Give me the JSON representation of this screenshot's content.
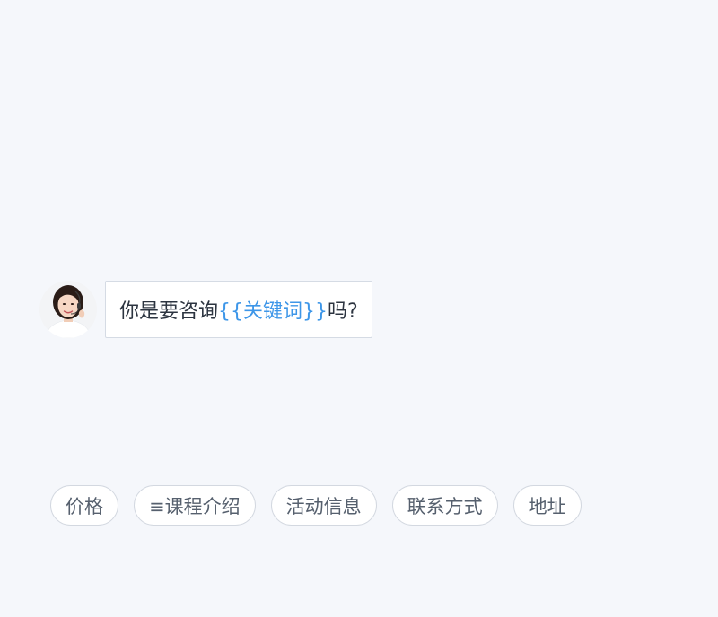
{
  "chat": {
    "message": {
      "prefix": "你是要咨询",
      "keyword": "{{关键词}}",
      "suffix": "吗?",
      "keyword_color": "#3d96e8"
    },
    "avatar_icon": "customer-service-agent-avatar"
  },
  "quick_replies": [
    {
      "label": "价格"
    },
    {
      "label": "≡课程介绍"
    },
    {
      "label": "活动信息"
    },
    {
      "label": "联系方式"
    },
    {
      "label": "地址"
    }
  ]
}
